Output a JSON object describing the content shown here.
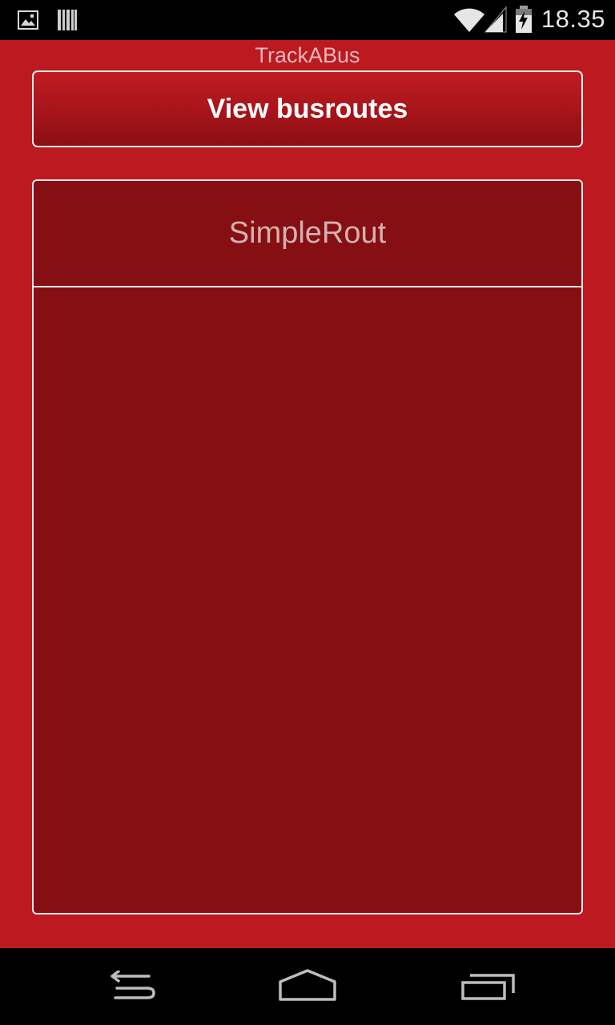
{
  "status_bar": {
    "time": "18.35",
    "icons": [
      "image-notification-icon",
      "barcode-notification-icon",
      "wifi-icon",
      "signal-icon",
      "battery-charging-icon"
    ]
  },
  "app": {
    "title": "TrackABus",
    "view_routes_label": "View busroutes",
    "route_header": "SimpleRout",
    "route_items": []
  },
  "colors": {
    "background": "#bd1920",
    "panel": "#850f13",
    "border": "#f2e6e6",
    "title_text": "#e4b9bb"
  },
  "nav_bar": {
    "buttons": [
      "back-icon",
      "home-icon",
      "recent-apps-icon"
    ]
  }
}
